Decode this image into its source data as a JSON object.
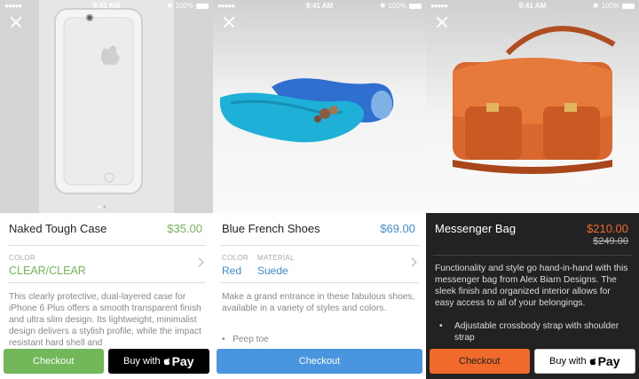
{
  "status_bar": {
    "time": "9:41 AM",
    "battery": "100%"
  },
  "products": [
    {
      "title": "Naked Tough Case",
      "price": "$35.00",
      "accent": "#72b85a",
      "options": [
        {
          "label": "COLOR",
          "value": "CLEAR/CLEAR"
        }
      ],
      "description": "This clearly protective, dual-layered case for iPhone 6 Plus offers a smooth transparent finish and ultra slim design. Its lightweight, minimalist design delivers a stylish profile, while the impact resistant hard shell and",
      "checkout_label": "Checkout",
      "apple_pay_prefix": "Buy with",
      "apple_pay_word": "Pay"
    },
    {
      "title": "Blue French Shoes",
      "price": "$69.00",
      "accent": "#3d8ed8",
      "options": [
        {
          "label": "COLOR",
          "value": "Red"
        },
        {
          "label": "MATERIAL",
          "value": "Suede"
        }
      ],
      "description": "Make a grand entrance in these fabulous shoes, available in a variety of styles and colors.",
      "bullets": [
        "Peep toe"
      ],
      "checkout_label": "Checkout"
    },
    {
      "title": "Messenger Bag",
      "price": "$210.00",
      "old_price": "$249.00",
      "accent": "#f06a2b",
      "description": "Functionality and style go hand-in-hand with this messenger bag from Alex Biarn Designs. The sleek finish and organized interior allows for easy access to all of your belongings.",
      "bullets": [
        "Adjustable crossbody strap with shoulder strap"
      ],
      "checkout_label": "Checkout",
      "apple_pay_prefix": "Buy with",
      "apple_pay_word": "Pay"
    }
  ]
}
